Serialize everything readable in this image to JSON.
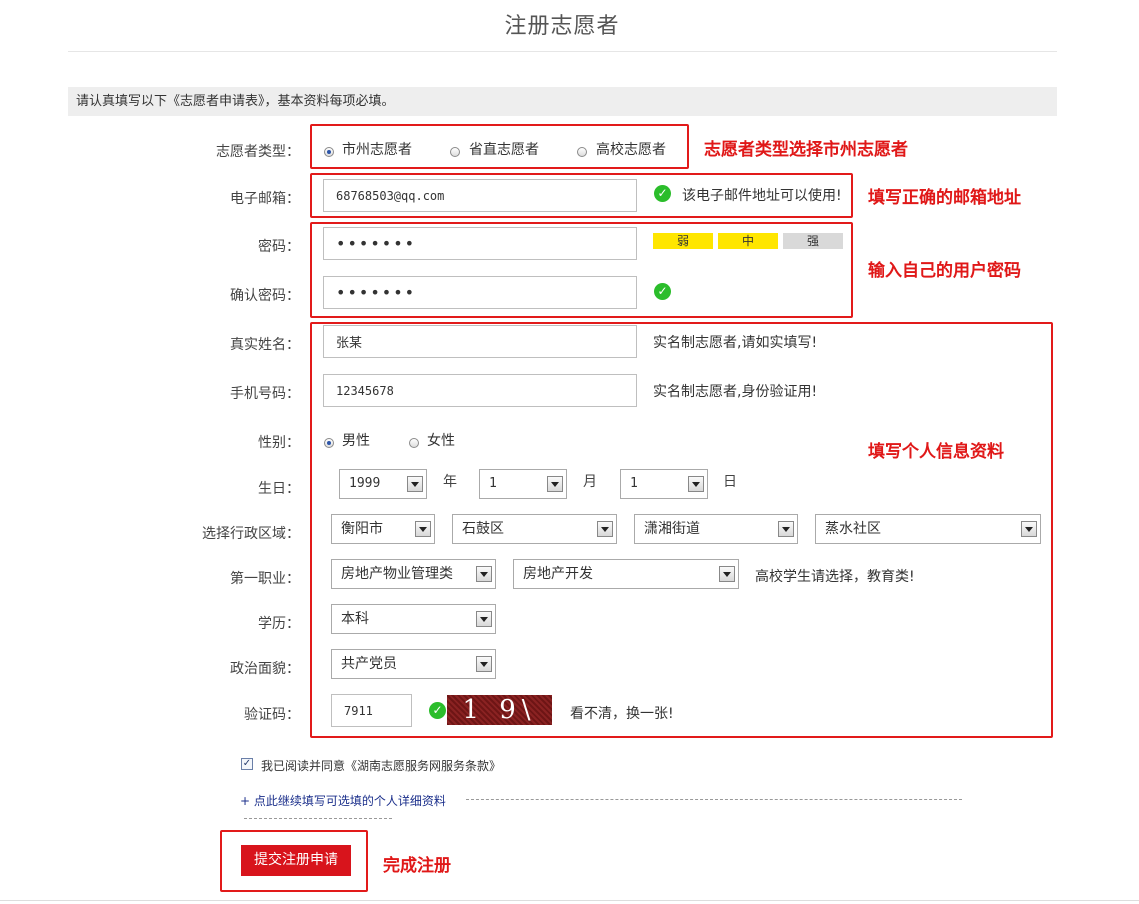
{
  "page": {
    "title": "注册志愿者",
    "notice": "请认真填写以下《志愿者申请表》，基本资料每项必填。"
  },
  "form": {
    "type_label": "志愿者类型：",
    "type_options": [
      "市州志愿者",
      "省直志愿者",
      "高校志愿者"
    ],
    "email_label": "电子邮箱：",
    "email_value": "68768503@qq.com",
    "email_hint": "该电子邮件地址可以使用!",
    "password_label": "密码：",
    "password_value": "•••••••",
    "strength": [
      "弱",
      "中",
      "强"
    ],
    "confirm_label": "确认密码：",
    "confirm_value": "•••••••",
    "name_label": "真实姓名：",
    "name_value": "张某",
    "name_hint": "实名制志愿者,请如实填写!",
    "phone_label": "手机号码：",
    "phone_value": "12345678",
    "phone_hint": "实名制志愿者,身份验证用!",
    "gender_label": "性别：",
    "gender_options": [
      "男性",
      "女性"
    ],
    "birthday_label": "生日：",
    "birth_year": "1999",
    "year_unit": "年",
    "birth_month": "1",
    "month_unit": "月",
    "birth_day": "1",
    "day_unit": "日",
    "region_label": "选择行政区域：",
    "region": [
      "衡阳市",
      "石鼓区",
      "潇湘街道",
      "蒸水社区"
    ],
    "job_label": "第一职业：",
    "job": [
      "房地产物业管理类",
      "房地产开发"
    ],
    "job_hint": "高校学生请选择，教育类!",
    "edu_label": "学历：",
    "edu_value": "本科",
    "politics_label": "政治面貌：",
    "politics_value": "共产党员",
    "captcha_label": "验证码：",
    "captcha_value": "7911",
    "captcha_image_text": "1 9\\ 1",
    "captcha_refresh": "看不清，换一张!",
    "agree_text": "我已阅读并同意《湖南志愿服务网服务条款》",
    "more_link": "+ 点此继续填写可选填的个人详细资料",
    "submit": "提交注册申请"
  },
  "annotations": {
    "type": "志愿者类型选择市州志愿者",
    "email": "填写正确的邮箱地址",
    "password": "输入自己的用户密码",
    "personal": "填写个人信息资料",
    "submit": "完成注册"
  },
  "colors": {
    "annotation_red": "#e01818",
    "submit_red": "#d8141c",
    "strength_yellow": "#ffe600",
    "strength_gray": "#d9d9d9",
    "ok_green": "#2bbd2b"
  },
  "icons": {
    "ok": "check-circle-icon"
  }
}
